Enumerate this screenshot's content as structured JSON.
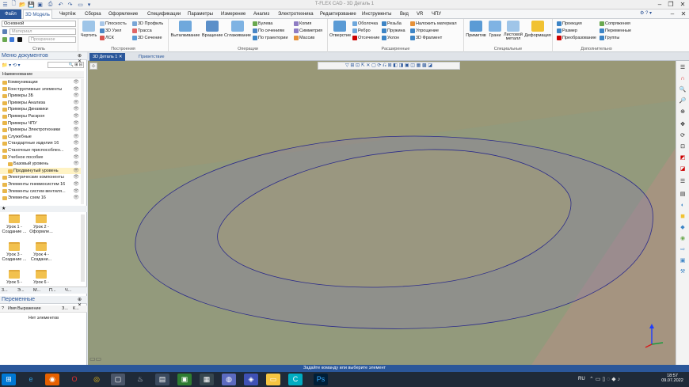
{
  "window": {
    "title": "T-FLEX CAD - 3D Деталь 1",
    "minimize": "–",
    "restore": "❐",
    "close": "✕"
  },
  "menu": {
    "items": [
      "Файл",
      "3D Модель",
      "Чертёж",
      "Сборка",
      "Оформление",
      "Спецификации",
      "Параметры",
      "Измерение",
      "Анализ",
      "Электротехника",
      "Редактирование",
      "Инструменты",
      "Вид",
      "VR",
      "ЧПУ"
    ],
    "help": "?",
    "extra": "⚙ ? ▾"
  },
  "ribbon": {
    "style": {
      "combo_main": "Основной",
      "combo_material": "Материал",
      "combo_transparency": "Прозрачное",
      "label": "Стиль"
    },
    "construct": {
      "draw": "Чертить",
      "plane": "Плоскость",
      "node3d": "3D Узел",
      "lsk": "ЛСК",
      "profile3d": "3D Профиль",
      "trace": "Трасса",
      "section3d": "3D Сечение",
      "label": "Построения"
    },
    "ops": {
      "extrude": "Выталкивание",
      "revolve": "Вращение",
      "smooth": "Сглаживание",
      "boolean": "Булева",
      "by_sections": "По сечениям",
      "by_path": "По траектории",
      "copy": "Копия",
      "symmetry": "Симметрия",
      "array": "Массив",
      "label": "Операции"
    },
    "ext": {
      "hole": "Отверстие",
      "shell": "Оболочка",
      "rib": "Ребро",
      "cut": "Отсечение",
      "thread": "Резьба",
      "spring": "Пружина",
      "slope": "Уклон",
      "apply_material": "Наложить материал",
      "simplify": "Упрощение",
      "fragment3d": "3D Фрагмент",
      "label": "Расширенные"
    },
    "special": {
      "primitives": "Примитив",
      "faces": "Грани",
      "sheet_metal": "Листовой металл",
      "deform": "Деформация",
      "label": "Специальные"
    },
    "extra": {
      "projection": "Проекция",
      "size": "Размер",
      "transform": "Преобразование",
      "relations": "Сопряжения",
      "variables": "Переменные",
      "groups": "Группы",
      "label": "Дополнительно"
    }
  },
  "doc_tabs": {
    "active": "3D Деталь 1",
    "other": "Приветствие"
  },
  "left_panel": {
    "title": "Меню документов",
    "col_header": "Наименование",
    "tree": [
      {
        "label": "Коммуникации",
        "selected": false
      },
      {
        "label": "Конструктивные элементы",
        "selected": false
      },
      {
        "label": "Примеры 3Б",
        "selected": false
      },
      {
        "label": "Примеры Анализа",
        "selected": false
      },
      {
        "label": "Примеры Динамики",
        "selected": false
      },
      {
        "label": "Примеры Раскроя",
        "selected": false
      },
      {
        "label": "Примеры ЧПУ",
        "selected": false
      },
      {
        "label": "Примеры Электротехники",
        "selected": false
      },
      {
        "label": "Служебные",
        "selected": false
      },
      {
        "label": "Стандартные изделия 16",
        "selected": false
      },
      {
        "label": "Станочные приспособлен...",
        "selected": false
      },
      {
        "label": "Учебное пособие",
        "selected": false
      },
      {
        "label": "Базовый уровень",
        "selected": false
      },
      {
        "label": "Продвинутый уровень",
        "selected": true
      },
      {
        "label": "Электрические компоненты",
        "selected": false
      },
      {
        "label": "Элементы пневмосистем 16",
        "selected": false
      },
      {
        "label": "Элементы систем вентиля...",
        "selected": false
      },
      {
        "label": "Элементы схем 16",
        "selected": false
      }
    ],
    "tiles": [
      {
        "label1": "Урок 1 -",
        "label2": "Создание ..."
      },
      {
        "label1": "Урок 2 -",
        "label2": "Оформле..."
      },
      {
        "label1": "Урок 3 -",
        "label2": "Создание ..."
      },
      {
        "label1": "Урок 4 -",
        "label2": "Создани..."
      },
      {
        "label1": "Урок 5 -",
        "label2": ""
      },
      {
        "label1": "Урок 6 -",
        "label2": ""
      }
    ],
    "bottom_tabs": [
      "3...",
      "Э...",
      "М...",
      "П...",
      "Ч..."
    ],
    "vars_title": "Переменные",
    "vars_cols": [
      "Имя",
      "Выражение",
      "З...",
      "К..."
    ],
    "vars_empty": "Нет элементов"
  },
  "status": {
    "prompt": "Задайте команду или выберите элемент"
  },
  "taskbar": {
    "lang": "RU",
    "time": "18:57",
    "date": "09.07.2022"
  }
}
